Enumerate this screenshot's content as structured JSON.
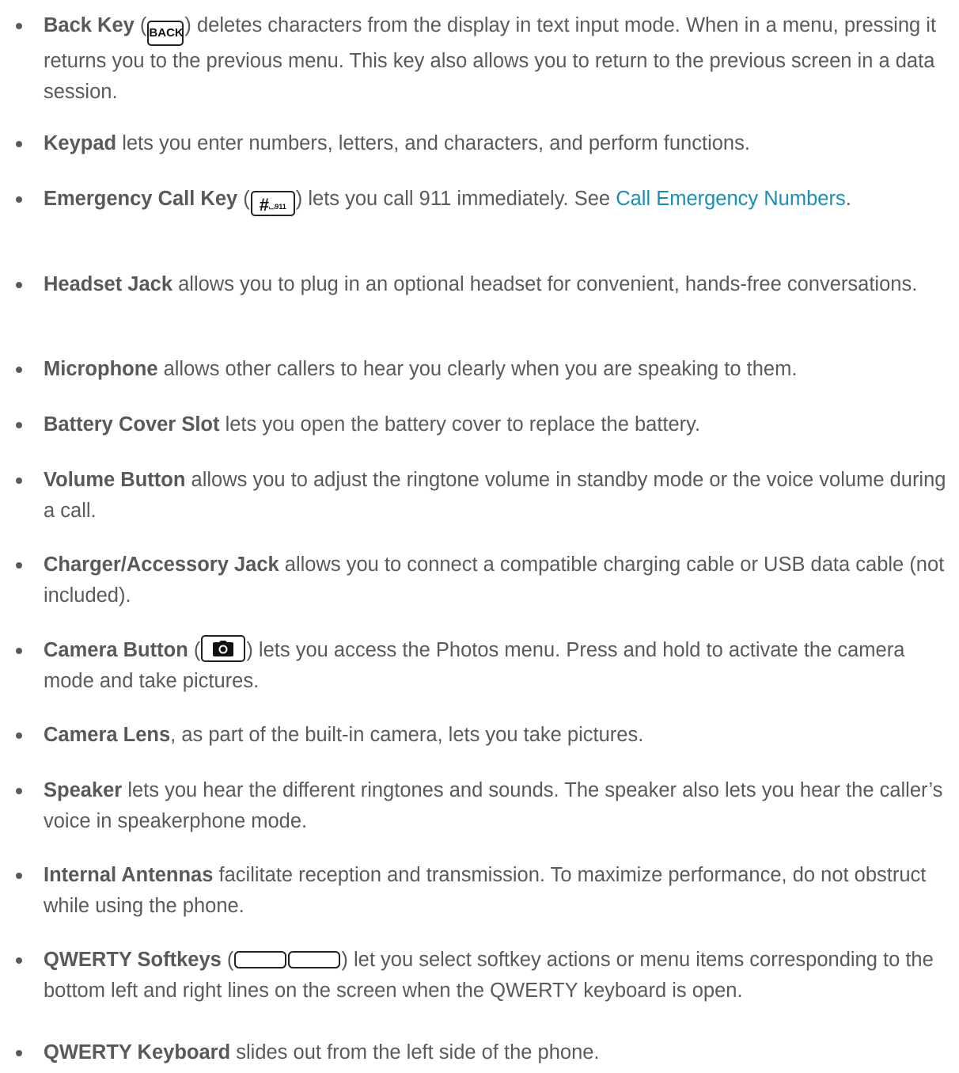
{
  "items": [
    {
      "term": "Back Key",
      "key_label": "BACK",
      "before_key": " (",
      "after_key": ") deletes characters from the display in text input mode. When in a menu, pressing it returns you to the previous menu. This key also allows you to return to the previous screen in a data session."
    },
    {
      "term": "Keypad",
      "text": " lets you enter numbers, letters, and characters, and perform functions."
    },
    {
      "term": "Emergency Call Key",
      "before_key": " (",
      "key_hash": "#",
      "key_num": "⌴911",
      "after_key": ") lets you call 911 immediately. See ",
      "link_text": "Call Emergency Numbers",
      "after_link": "."
    },
    {
      "term": "Headset Jack",
      "text": " allows you to plug in an optional headset for convenient, hands-free conversations."
    },
    {
      "term": "Microphone",
      "text": " allows other callers to hear you clearly when you are speaking to them."
    },
    {
      "term": "Battery Cover Slot",
      "text": " lets you open the battery cover to replace the battery."
    },
    {
      "term": "Volume Button",
      "text": " allows you to adjust the ringtone volume in standby mode or the voice volume during a call."
    },
    {
      "term": "Charger/Accessory Jack",
      "text": " allows you to connect a compatible charging cable or USB data cable (not included)."
    },
    {
      "term": "Camera Button",
      "before_key": " (",
      "key_icon": "camera-icon",
      "after_key": ") lets you access the Photos menu. Press and hold to activate the camera mode and take pictures."
    },
    {
      "term": "Camera Lens",
      "text": ", as part of the built-in camera, lets you take pictures."
    },
    {
      "term": "Speaker",
      "text": " lets you hear the different ringtones and sounds. The speaker also lets you hear the caller’s voice in speakerphone mode."
    },
    {
      "term": "Internal Antennas",
      "text": " facilitate reception and transmission. To maximize performance, do not obstruct while using the phone."
    },
    {
      "term": "QWERTY Softkeys",
      "before_key": " (",
      "key_icon": "softkey-icon",
      "after_key": ") let you select softkey actions or menu items corresponding to the bottom left and right lines on the screen when the QWERTY keyboard is open."
    },
    {
      "term": "QWERTY Keyboard",
      "text": " slides out from the left side of the phone."
    }
  ],
  "colors": {
    "text": "#595959",
    "link": "#1a8fb5",
    "key_border": "#222222"
  }
}
